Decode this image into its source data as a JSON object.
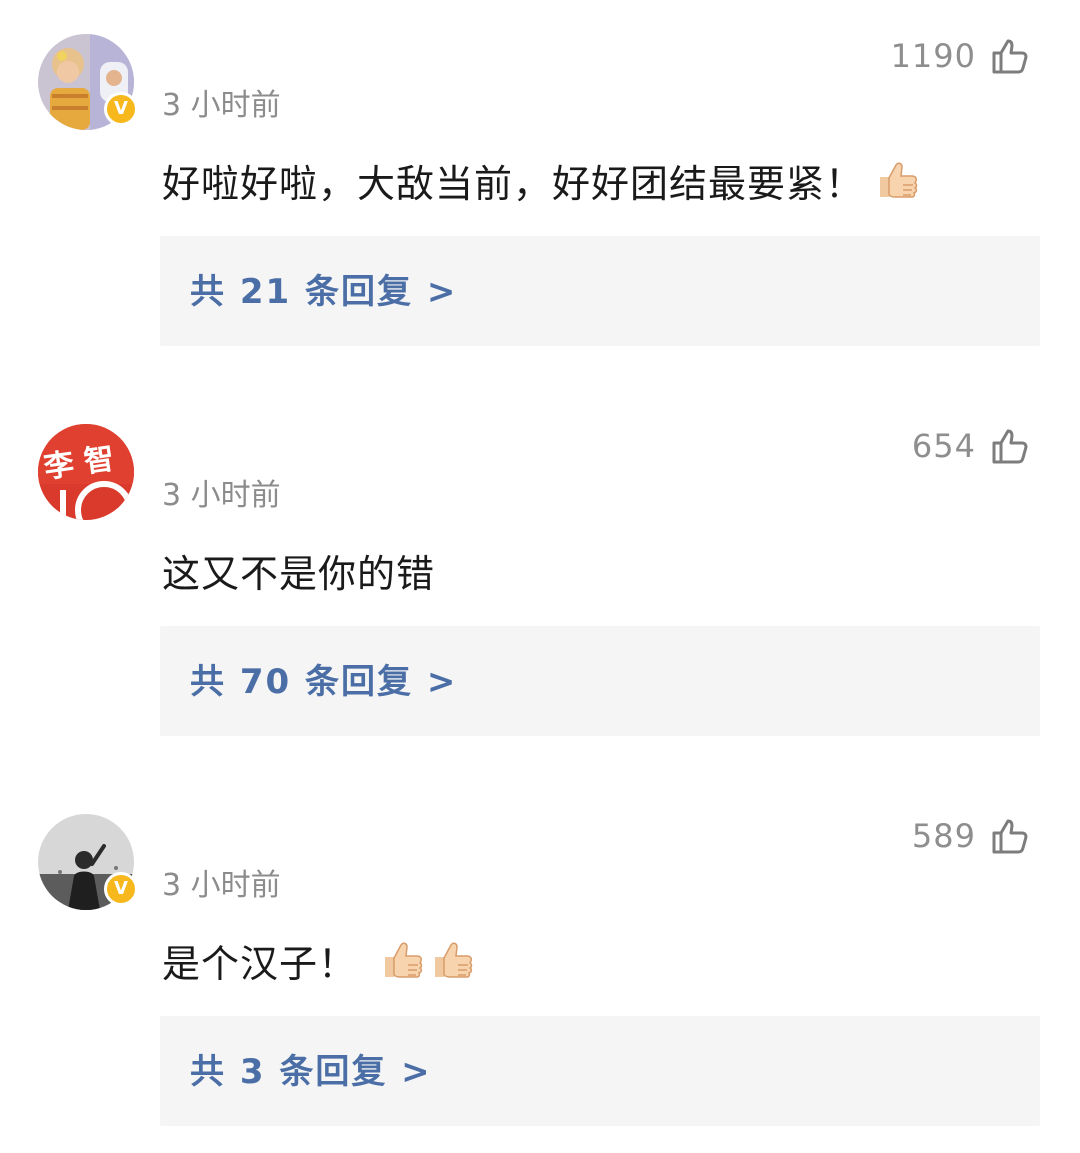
{
  "comments": [
    {
      "time": "3 小时前",
      "likes": "1190",
      "text": "好啦好啦，大敌当前，好好团结最要紧！",
      "emoji_count": 1,
      "reply_link": "共 21 条回复 >",
      "verified": true,
      "avatar_icon": "user-avatar-girl-photo"
    },
    {
      "time": "3 小时前",
      "likes": "654",
      "text": "这又不是你的错",
      "emoji_count": 0,
      "reply_link": "共 70 条回复 >",
      "verified": false,
      "avatar_icon": "user-avatar-red-logo"
    },
    {
      "time": "3 小时前",
      "likes": "589",
      "text": "是个汉子！",
      "emoji_count": 2,
      "reply_link": "共 3 条回复 >",
      "verified": true,
      "avatar_icon": "user-avatar-bw-photo"
    }
  ],
  "badge_letter": "V",
  "avatar_logo_text": "李 智",
  "colors": {
    "reply_link": "#4a6ea5",
    "timestamp": "#8c8c8c",
    "verified_badge": "#f6b81c",
    "reply_bg": "#f5f5f5"
  },
  "icons": {
    "like": "thumbs-up-outline-icon",
    "emoji": "thumbs-up-emoji"
  }
}
